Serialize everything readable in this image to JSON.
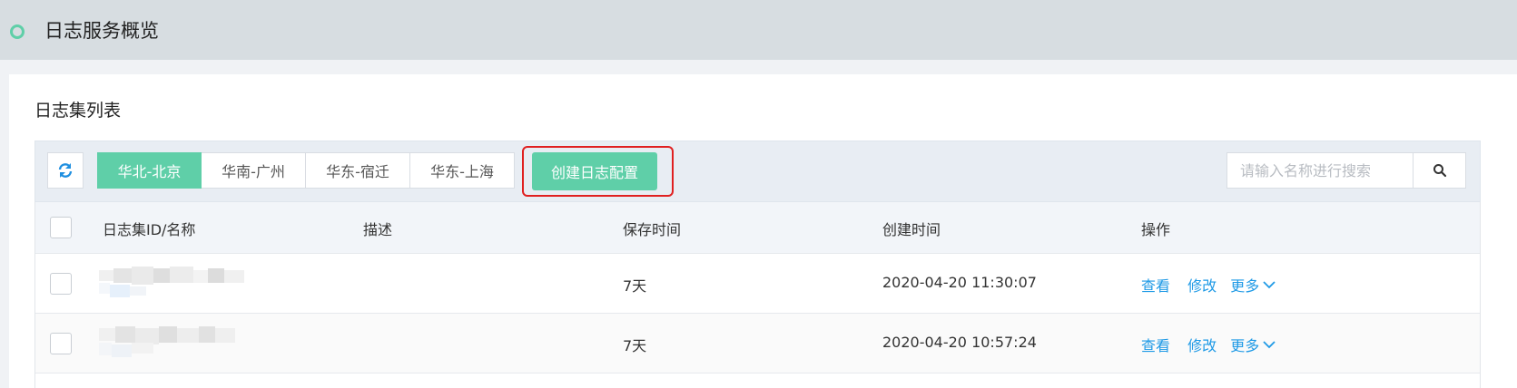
{
  "header": {
    "title": "日志服务概览"
  },
  "section": {
    "title": "日志集列表"
  },
  "toolbar": {
    "regions": [
      "华北-北京",
      "华南-广州",
      "华东-宿迁",
      "华东-上海"
    ],
    "active_region": "华北-北京",
    "create_label": "创建日志配置",
    "search_placeholder": "请输入名称进行搜索"
  },
  "table": {
    "columns": [
      "日志集ID/名称",
      "描述",
      "保存时间",
      "创建时间",
      "操作"
    ],
    "rows": [
      {
        "name": "",
        "desc": "",
        "retention": "7天",
        "created": "2020-04-20 11:30:07",
        "actions": [
          "查看",
          "修改",
          "更多"
        ]
      },
      {
        "name": "",
        "desc": "",
        "retention": "7天",
        "created": "2020-04-20 10:57:24",
        "actions": [
          "查看",
          "修改",
          "更多"
        ]
      }
    ]
  },
  "colors": {
    "accent": "#5fcfa8",
    "link": "#1f9ae6",
    "highlight": "#e02020"
  },
  "icons": [
    "circle-icon",
    "refresh-icon",
    "search-icon",
    "chevron-down-icon"
  ]
}
